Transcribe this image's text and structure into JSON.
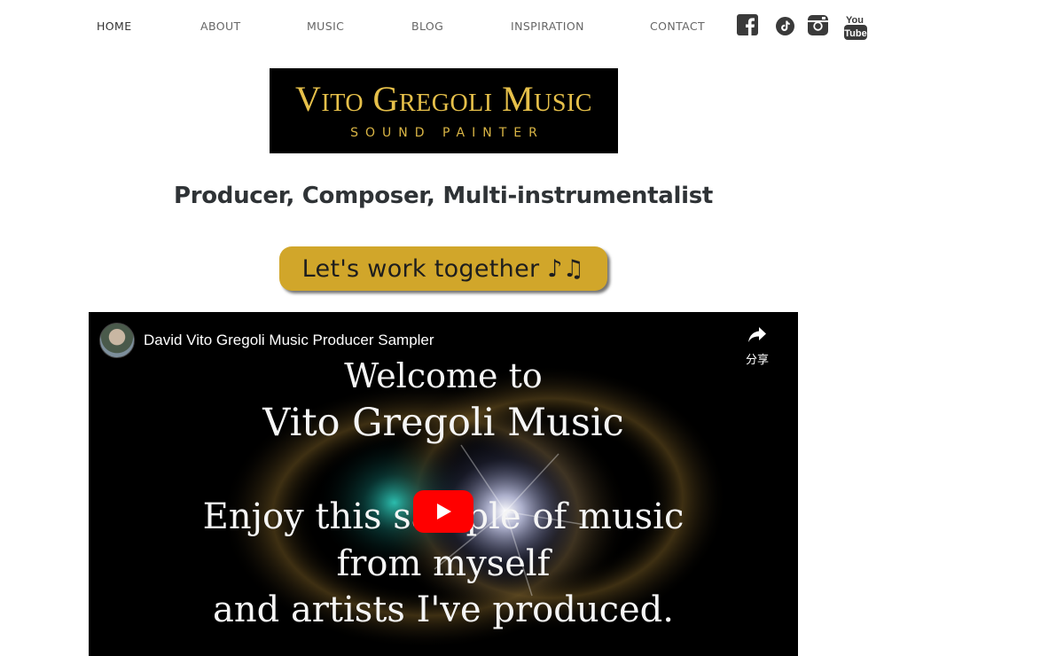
{
  "nav": {
    "items": [
      {
        "label": "HOME",
        "active": true
      },
      {
        "label": "ABOUT"
      },
      {
        "label": "MUSIC"
      },
      {
        "label": "BLOG"
      },
      {
        "label": "INSPIRATION"
      },
      {
        "label": "CONTACT"
      }
    ],
    "social": [
      "facebook-icon",
      "tiktok-icon",
      "instagram-icon",
      "youtube-icon"
    ],
    "youtube_text_top": "You",
    "youtube_text_bottom": "Tube"
  },
  "logo": {
    "title": "Vito Gregoli Music",
    "subtitle": "SOUND PAINTER",
    "text_color": "#e6c04a"
  },
  "tagline": "Producer, Composer, Multi-instrumentalist",
  "cta": {
    "label": "Let's work together ♪♫",
    "color": "#d1a62a"
  },
  "video": {
    "title": "David Vito Gregoli Music Producer Sampler",
    "share_label": "分享",
    "lines": [
      "Welcome to",
      "Vito Gregoli Music",
      "Enjoy this sample of music",
      "from myself",
      "and artists I've produced."
    ],
    "play_color": "#ff0000"
  }
}
